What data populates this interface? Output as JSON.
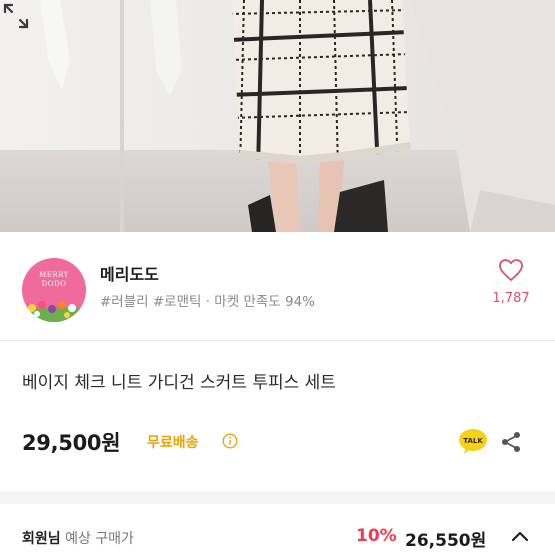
{
  "seller": {
    "name": "메리도도",
    "avatar_text_line1": "MERRY",
    "avatar_text_line2": "DODO",
    "tags": "#러블리 #로맨틱 · 마켓 만족도 94%",
    "like_count": "1,787"
  },
  "product": {
    "title": "베이지 체크 니트 가디건 스커트 투피스 세트",
    "price": "29,500원",
    "shipping": "무료배송"
  },
  "member_price": {
    "label_bold": "회원님",
    "label_rest": " 예상 구매가",
    "discount": "10%",
    "price": "26,550원"
  },
  "icons": {
    "expand": "expand-icon",
    "like": "heart-icon",
    "info": "info-icon",
    "talk": "kakaotalk-icon",
    "share": "share-icon",
    "chevron": "chevron-up-icon"
  },
  "colors": {
    "accent_pink": "#e0505f",
    "shipping_yellow": "#e9a30a",
    "discount_red": "#f23b4c",
    "kakao_yellow": "#f7d117"
  }
}
